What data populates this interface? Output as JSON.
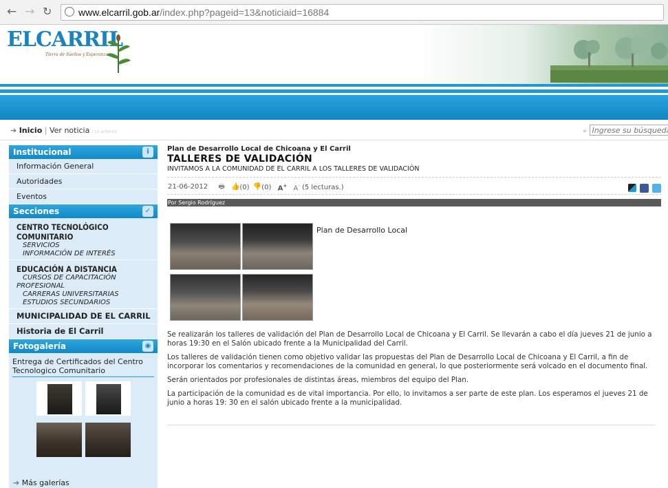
{
  "browser": {
    "url_domain": "www.elcarril.gob.ar",
    "url_path": "/index.php?pageid=13&noticiaid=16884"
  },
  "header": {
    "logo_text": "ELCARRIL",
    "logo_tagline": "Tierra de Sueños y Esperanzas"
  },
  "breadcrumb": {
    "home": "Inicio",
    "sep": "|",
    "current": "Ver noticia",
    "trail": "| Lo anterior"
  },
  "search": {
    "prefix": "»",
    "placeholder": "Ingrese su búsqueda"
  },
  "sidebar": {
    "institucional_title": "Institucional",
    "institucional_items": [
      "Información General",
      "Autoridades",
      "Eventos"
    ],
    "secciones_title": "Secciones",
    "groups": [
      {
        "title": "CENTRO TECNOLÓGICO COMUNITARIO",
        "subs": [
          "SERVICIOS",
          "INFORMACIÓN DE INTERÉS"
        ]
      },
      {
        "title": "EDUCACIÓN A DISTANCIA",
        "sub1": "CURSOS DE CAPACITACIÓN",
        "sub1b": "PROFESIONAL",
        "subs": [
          "CARRERAS UNIVERSITARIAS",
          "ESTUDIOS SECUNDARIOS"
        ]
      }
    ],
    "municipalidad": "MUNICIPALIDAD DE EL CARRIL",
    "historia": "Historia de El Carril",
    "fotogaleria_title": "Fotogalería",
    "gallery_title": "Entrega de Certificados del Centro Tecnologico Comunitario",
    "more_galleries": "Más galerías"
  },
  "article": {
    "kicker": "Plan de Desarrollo Local de Chicoana y El Carril",
    "title": "TALLERES DE VALIDACIÓN",
    "subtitle": "INVITAMOS A LA COMUNIDAD DE EL CARRIL A LOS TALLERES DE VALIDACIÓN",
    "date": "21-06-2012",
    "likes": "(0)",
    "dislikes": "(0)",
    "reads": "(5 lecturas.)",
    "byline": "Por Sergio Rodríguez",
    "photo_caption": "Plan de Desarrollo Local",
    "paragraphs": [
      "Se realizarán los talleres de validación del Plan de Desarrollo Local de Chicoana y El Carril. Se llevarán a cabo el día jueves 21 de junio a  horas 19:30 en el Salón ubicado frente a la Municipalidad del Carril.",
      "Los talleres de validación tienen como objetivo validar las propuestas del Plan de Desarrollo Local de Chicoana y El Carril, a fin de incorporar los comentarios y recomendaciones de la comunidad en general, lo que posteriormente será volcado en el documento final.",
      "Serán orientados por profesionales de distintas áreas, miembros del equipo del Plan.",
      "La participación de la comunidad es de vital importancia. Por ello, lo invitamos a ser parte de este plan. Los esperamos el jueves 21 de junio a horas 19: 30 en el salón ubicado frente a la municipalidad."
    ]
  },
  "colors": {
    "accent": "#1b9ad3",
    "sidebar_bg": "#dbecf8",
    "byline_bg": "#5a5a5a"
  }
}
